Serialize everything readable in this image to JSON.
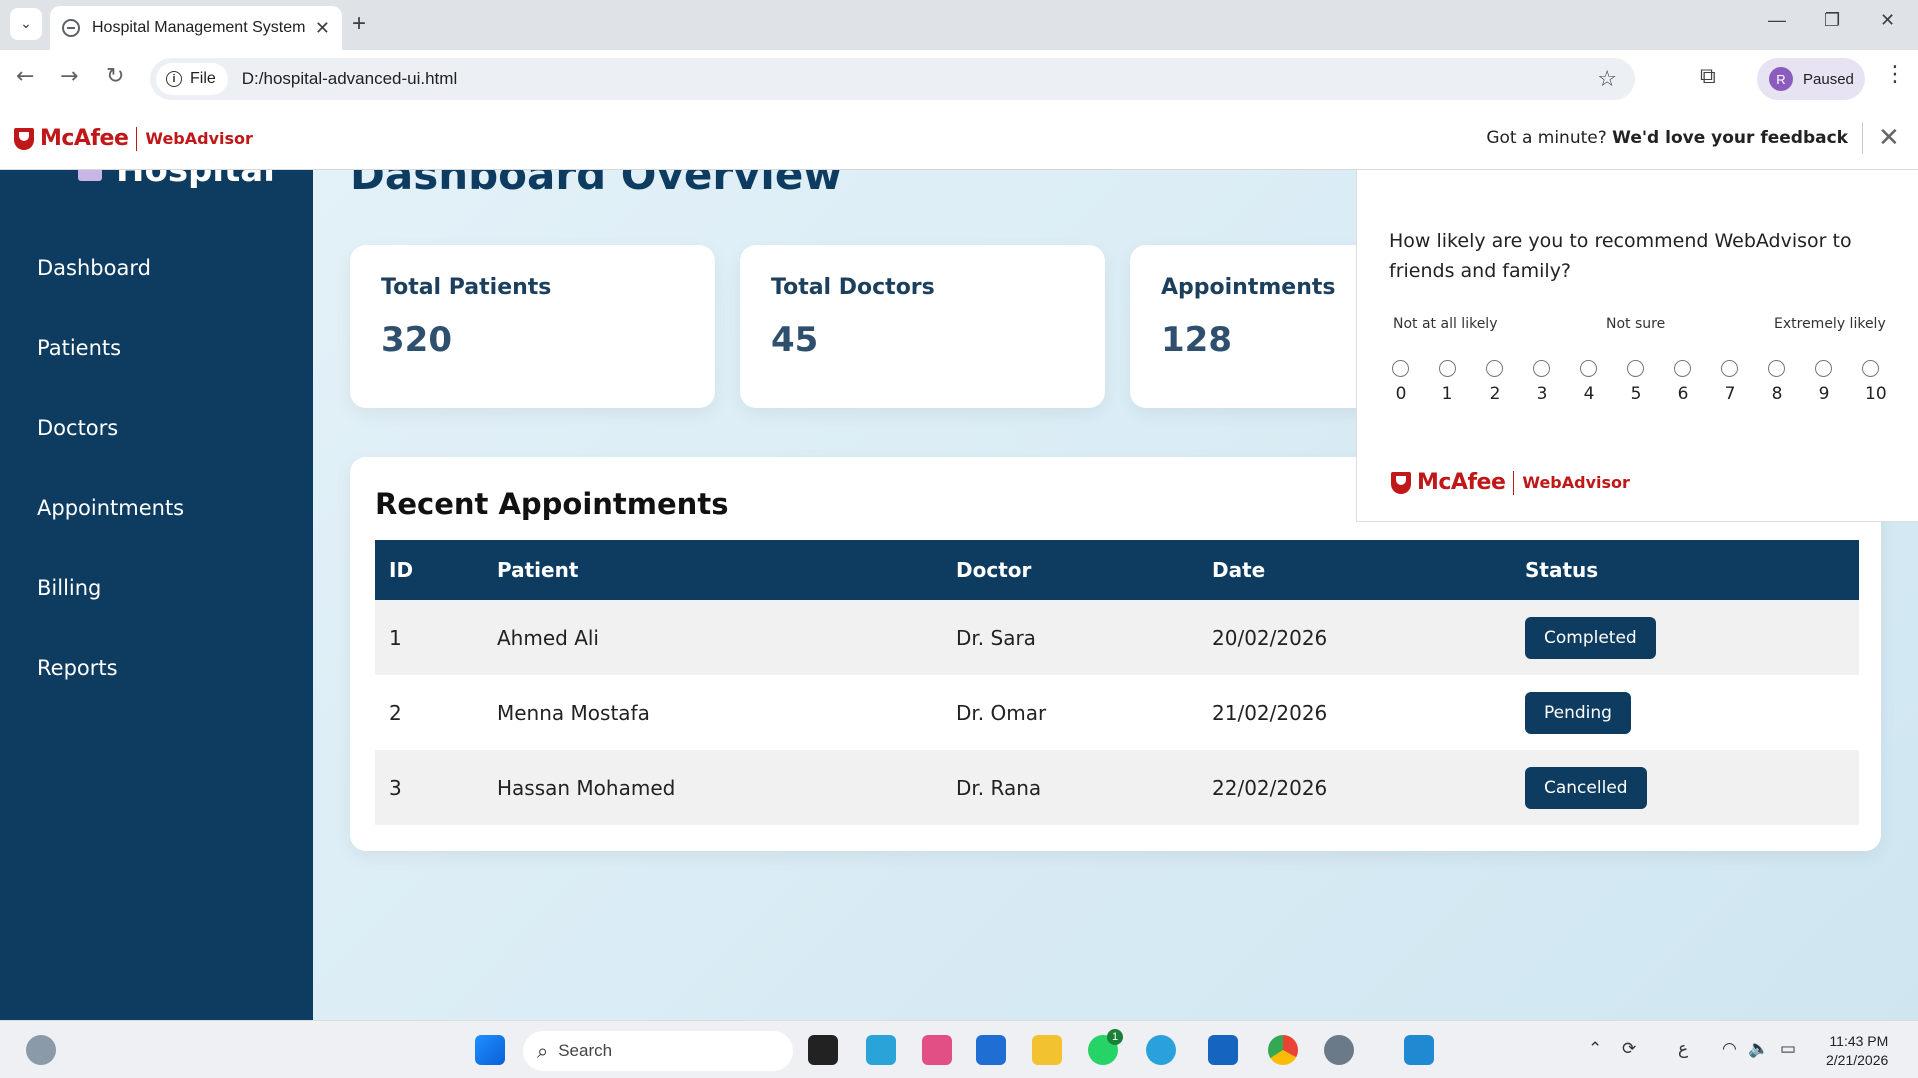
{
  "browser": {
    "tab_title": "Hospital Management System",
    "file_label": "File",
    "url": "D:/hospital-advanced-ui.html",
    "profile_initial": "R",
    "profile_status": "Paused"
  },
  "mcafee_bar": {
    "brand": "McAfee",
    "product": "WebAdvisor",
    "prompt": "Got a minute?",
    "prompt_bold": "We'd love your feedback"
  },
  "survey": {
    "question": "How likely are you to recommend WebAdvisor to friends and family?",
    "label_low": "Not at all likely",
    "label_mid": "Not sure",
    "label_high": "Extremely likely",
    "scale": [
      "0",
      "1",
      "2",
      "3",
      "4",
      "5",
      "6",
      "7",
      "8",
      "9",
      "10"
    ],
    "brand": "McAfee",
    "product": "WebAdvisor"
  },
  "sidebar": {
    "brand": "Hospital",
    "items": [
      {
        "label": "Dashboard"
      },
      {
        "label": "Patients"
      },
      {
        "label": "Doctors"
      },
      {
        "label": "Appointments"
      },
      {
        "label": "Billing"
      },
      {
        "label": "Reports"
      }
    ]
  },
  "main": {
    "title": "Dashboard Overview",
    "cards": [
      {
        "label": "Total Patients",
        "value": "320"
      },
      {
        "label": "Total Doctors",
        "value": "45"
      },
      {
        "label": "Appointments",
        "value": "128"
      }
    ],
    "appointments": {
      "title": "Recent Appointments",
      "columns": [
        "ID",
        "Patient",
        "Doctor",
        "Date",
        "Status"
      ],
      "rows": [
        {
          "id": "1",
          "patient": "Ahmed Ali",
          "doctor": "Dr. Sara",
          "date": "20/02/2026",
          "status": "Completed"
        },
        {
          "id": "2",
          "patient": "Menna Mostafa",
          "doctor": "Dr. Omar",
          "date": "21/02/2026",
          "status": "Pending"
        },
        {
          "id": "3",
          "patient": "Hassan Mohamed",
          "doctor": "Dr. Rana",
          "date": "22/02/2026",
          "status": "Cancelled"
        }
      ]
    }
  },
  "taskbar": {
    "search_placeholder": "Search",
    "whatsapp_badge": "1",
    "lang": "ع",
    "time": "11:43 PM",
    "date": "2/21/2026"
  },
  "colors": {
    "sidebar": "#0e3c60",
    "accent": "#0e3c60",
    "mcafee_red": "#c01818"
  }
}
